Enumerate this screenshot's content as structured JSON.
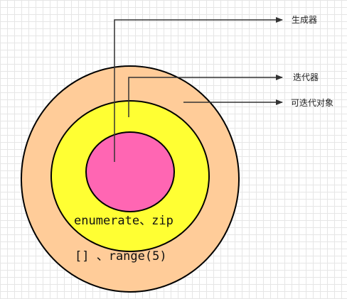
{
  "diagram": {
    "labels": {
      "generator": "生成器",
      "iterator": "迭代器",
      "iterable": "可迭代对象"
    },
    "inner_text": "enumerate、zip",
    "outer_text": "[] 、range(5)",
    "colors": {
      "outer_ring": "#FFCC99",
      "middle_ring": "#FFFF33",
      "inner_circle": "#FF66B3",
      "stroke": "#000000",
      "arrow": "#333333",
      "grid": "#E6E6E6"
    }
  }
}
